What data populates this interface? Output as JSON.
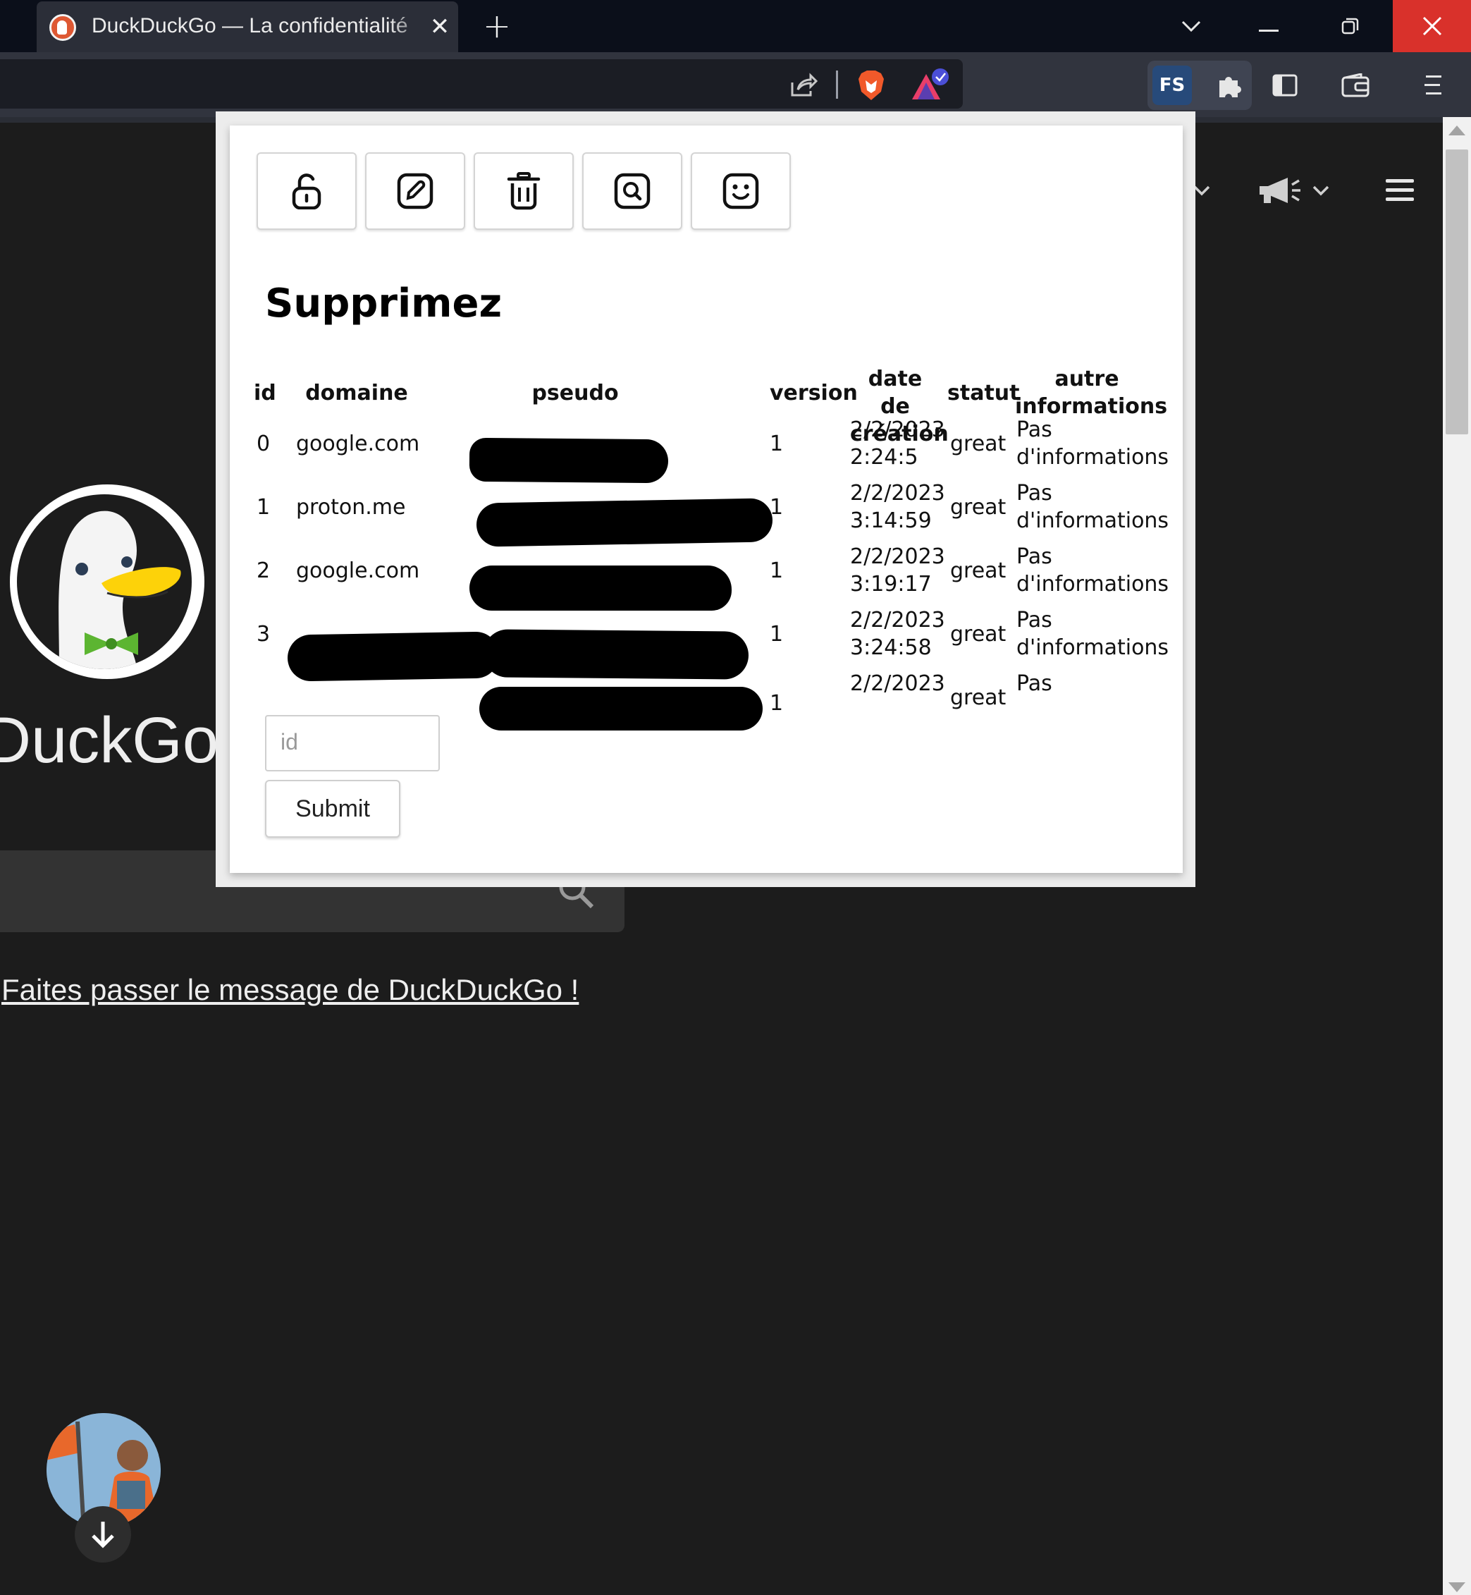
{
  "browser": {
    "tab_title": "DuckDuckGo — La confidentialité",
    "tab_close": "✕",
    "new_tab": "+",
    "fs_badge": "FS"
  },
  "page": {
    "brand": "ckDuckGo",
    "spread_link": "Faites passer le message de DuckDuckGo !"
  },
  "popup": {
    "heading": "Supprimez",
    "toolbar_icons": [
      "unlock-icon",
      "edit-icon",
      "trash-icon",
      "search-icon",
      "smile-icon"
    ],
    "table": {
      "headers": {
        "id": "id",
        "domaine": "domaine",
        "pseudo": "pseudo",
        "version": "version",
        "date_line1": "date de",
        "date_line2": "création",
        "statut": "statut",
        "autre_line1": "autre",
        "autre_line2": "informations"
      },
      "rows": [
        {
          "id": "0",
          "domaine": "google.com",
          "version": "1",
          "date1": "2/2/2023",
          "date2": "2:24:5",
          "statut": "great",
          "autre1": "Pas",
          "autre2": "d'informations"
        },
        {
          "id": "1",
          "domaine": "proton.me",
          "version": "1",
          "date1": "2/2/2023",
          "date2": "3:14:59",
          "statut": "great",
          "autre1": "Pas",
          "autre2": "d'informations"
        },
        {
          "id": "2",
          "domaine": "google.com",
          "version": "1",
          "date1": "2/2/2023",
          "date2": "3:19:17",
          "statut": "great",
          "autre1": "Pas",
          "autre2": "d'informations"
        },
        {
          "id": "3",
          "domaine": "",
          "version": "1",
          "date1": "2/2/2023",
          "date2": "3:24:58",
          "statut": "great",
          "autre1": "Pas",
          "autre2": "d'informations"
        },
        {
          "id": "",
          "domaine": "",
          "version": "1",
          "date1": "2/2/2023",
          "date2": "",
          "statut": "great",
          "autre1": "Pas",
          "autre2": ""
        }
      ]
    },
    "id_placeholder": "id",
    "submit_label": "Submit"
  },
  "colors": {
    "page_bg": "#1c1c1c",
    "titlebar_bg": "#0b0f1a",
    "window_close": "#d9312b",
    "popup_bg": "#ffffff"
  }
}
